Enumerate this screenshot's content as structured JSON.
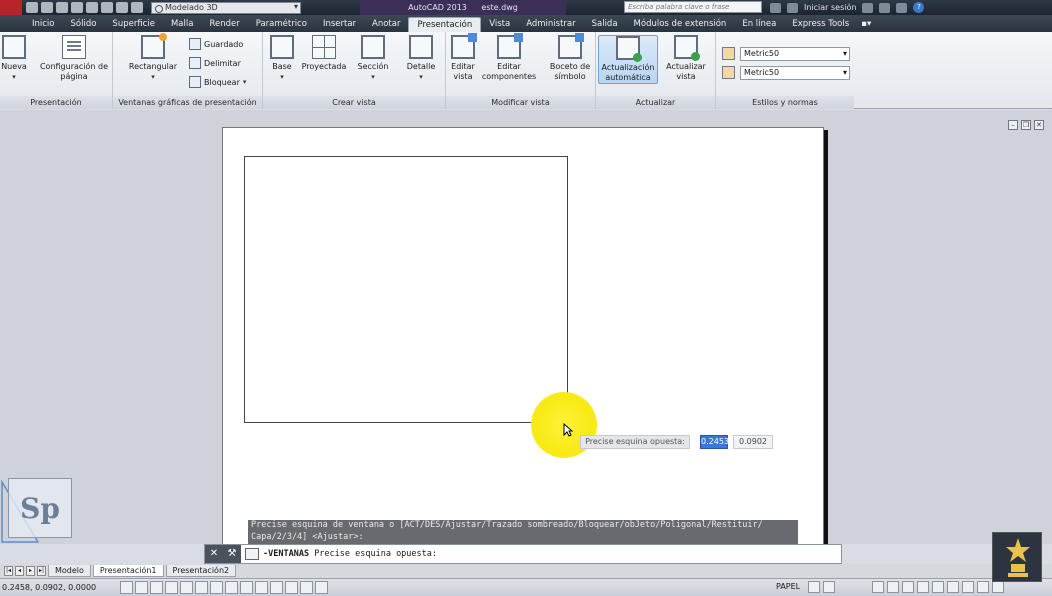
{
  "titlebar": {
    "workspace": "Modelado 3D",
    "app_name": "AutoCAD 2013",
    "file_name": "este.dwg",
    "search_placeholder": "Escriba palabra clave o frase",
    "signin": "Iniciar sesión",
    "help": "?"
  },
  "tabs": [
    "Inicio",
    "Sólido",
    "Superficie",
    "Malla",
    "Render",
    "Paramétrico",
    "Insertar",
    "Anotar",
    "Presentación",
    "Vista",
    "Administrar",
    "Salida",
    "Módulos de extensión",
    "En línea",
    "Express Tools"
  ],
  "active_tab": "Presentación",
  "ribbon": {
    "panels": {
      "presentacion": "Presentación",
      "ventanas": "Ventanas gráficas de presentación",
      "crear_vista": "Crear vista",
      "modificar_vista": "Modificar vista",
      "actualizar": "Actualizar",
      "estilos": "Estilos y normas"
    },
    "buttons": {
      "nueva": "Nueva",
      "config_pagina_1": "Configuración de",
      "config_pagina_2": "página",
      "rectangular": "Rectangular",
      "guardado": "Guardado",
      "delimitar": "Delimitar",
      "bloquear": "Bloquear",
      "base": "Base",
      "proyectada": "Proyectada",
      "seccion": "Sección",
      "detalle": "Detalle",
      "editar_vista_1": "Editar",
      "editar_vista_2": "vista",
      "editar_comp_1": "Editar",
      "editar_comp_2": "componentes",
      "boceto_1": "Boceto de",
      "boceto_2": "símbolo",
      "act_auto_1": "Actualización",
      "act_auto_2": "automática",
      "act_vista_1": "Actualizar",
      "act_vista_2": "vista"
    },
    "styles": [
      "Metric50",
      "Metric50"
    ]
  },
  "canvas": {
    "prompt_label": "Precise esquina opuesta:",
    "coord_x": "0.2453",
    "coord_y": "0.0902"
  },
  "command": {
    "history_1": "Precise esquina de ventana o [ACT/DES/Ajustar/Trazado sombreado/Bloquear/obJeto/Poligonal/Restituir/",
    "history_2": "Capa/2/3/4] <Ajustar>:",
    "current_cmd": "-VENTANAS",
    "current_prompt": "Precise esquina opuesta:"
  },
  "layout_tabs": [
    "Modelo",
    "Presentación1",
    "Presentación2"
  ],
  "active_layout": "Presentación1",
  "status": {
    "coords": "0.2458, 0.0902, 0.0000",
    "space": "PAPEL"
  },
  "logo": {
    "text": "Sp"
  },
  "colors": {
    "highlight": "#f7ea14",
    "ribbon_active": "#b9d5f2",
    "titlebar": "#2e3a48"
  }
}
